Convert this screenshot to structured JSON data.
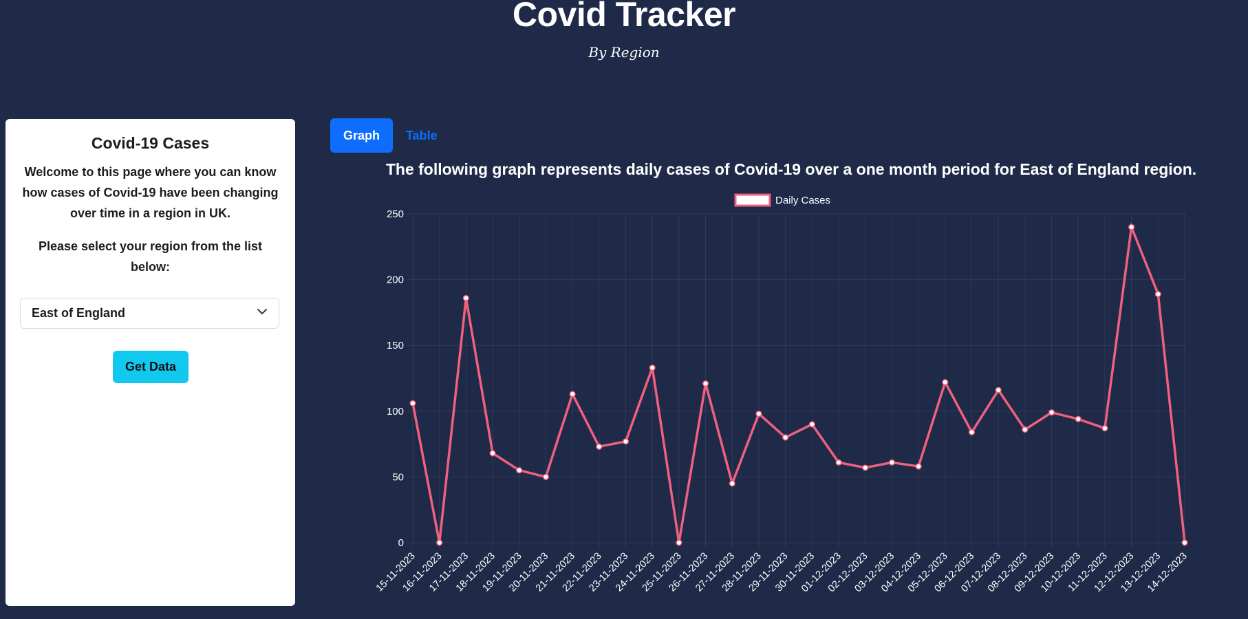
{
  "header": {
    "title": "Covid Tracker",
    "subtitle": "By Region"
  },
  "sidebar": {
    "heading": "Covid-19 Cases",
    "welcome": "Welcome to this page where you can know how cases of Covid-19 have been changing over time in a region in UK.",
    "prompt": "Please select your region from the list below:",
    "region_select": {
      "value": "East of England"
    },
    "get_data_label": "Get Data"
  },
  "tabs": [
    {
      "label": "Graph",
      "active": true
    },
    {
      "label": "Table",
      "active": false
    }
  ],
  "chart_heading": "The following graph represents daily cases of Covid-19 over a one month period for East of England region.",
  "colors": {
    "background": "#1f2a48",
    "line": "#f0607f",
    "primary": "#0d6efd",
    "accent": "#11c9ef"
  },
  "chart_data": {
    "type": "line",
    "categories": [
      "15-11-2023",
      "16-11-2023",
      "17-11-2023",
      "18-11-2023",
      "19-11-2023",
      "20-11-2023",
      "21-11-2023",
      "22-11-2023",
      "23-11-2023",
      "24-11-2023",
      "25-11-2023",
      "26-11-2023",
      "27-11-2023",
      "28-11-2023",
      "29-11-2023",
      "30-11-2023",
      "01-12-2023",
      "02-12-2023",
      "03-12-2023",
      "04-12-2023",
      "05-12-2023",
      "06-12-2023",
      "07-12-2023",
      "08-12-2023",
      "09-12-2023",
      "10-12-2023",
      "11-12-2023",
      "12-12-2023",
      "13-12-2023",
      "14-12-2023"
    ],
    "series": [
      {
        "name": "Daily Cases",
        "values": [
          106,
          0,
          186,
          68,
          55,
          50,
          113,
          73,
          77,
          133,
          0,
          121,
          45,
          98,
          80,
          90,
          61,
          57,
          61,
          58,
          122,
          84,
          116,
          86,
          99,
          94,
          87,
          240,
          189,
          0
        ]
      }
    ],
    "ylim": [
      0,
      250
    ],
    "yticks": [
      0,
      50,
      100,
      150,
      200,
      250
    ],
    "legend": "top",
    "grid": true
  }
}
